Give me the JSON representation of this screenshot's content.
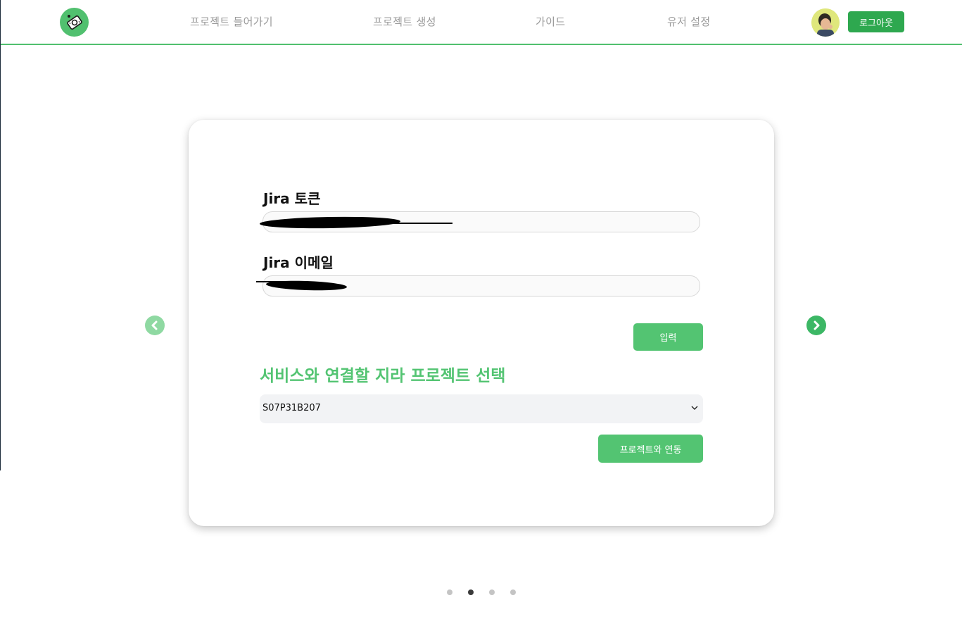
{
  "header": {
    "nav": [
      {
        "label": "프로젝트 들어가기"
      },
      {
        "label": "프로젝트 생성"
      },
      {
        "label": "가이드"
      },
      {
        "label": "유저 설정"
      }
    ],
    "logout_label": "로그아웃",
    "logo_icon": "tape-measure-icon",
    "accent_color": "#51c06f"
  },
  "form": {
    "token_label": "Jira 토큰",
    "token_value": "",
    "email_label": "Jira 이메일",
    "email_value": "",
    "submit_label": "입력",
    "section_title": "서비스와 연결할 지라 프로젝트 선택",
    "selected_project": "S07P31B207",
    "link_button_label": "프로젝트와 연동"
  },
  "carousel": {
    "prev_icon": "chevron-left-icon",
    "next_icon": "chevron-right-icon",
    "total_slides": 4,
    "active_slide": 2
  }
}
